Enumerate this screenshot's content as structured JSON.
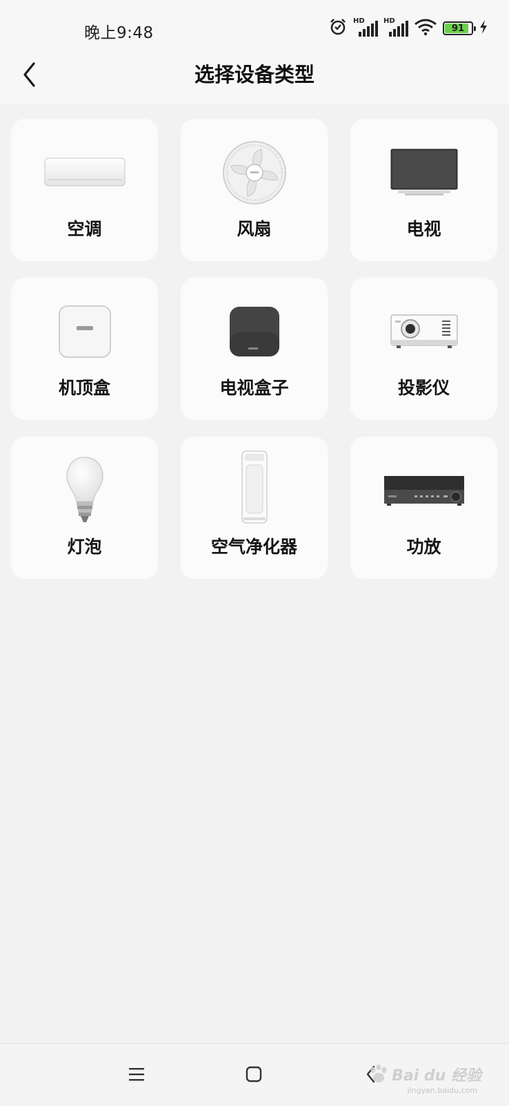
{
  "status_bar": {
    "time": "晚上9:48",
    "hd_label_1": "HD",
    "hd_label_2": "HD",
    "battery_text": "91",
    "battery_level": 0.91,
    "battery_color": "#6ad14a",
    "icons": [
      "alarm-icon",
      "signal-icon",
      "signal-icon",
      "wifi-icon",
      "battery-icon",
      "charging-icon"
    ]
  },
  "header": {
    "title": "选择设备类型",
    "back_icon": "back-chevron-icon"
  },
  "devices": [
    {
      "label": "空调",
      "icon": "air-conditioner-icon"
    },
    {
      "label": "风扇",
      "icon": "fan-icon"
    },
    {
      "label": "电视",
      "icon": "tv-icon"
    },
    {
      "label": "机顶盒",
      "icon": "set-top-box-icon"
    },
    {
      "label": "电视盒子",
      "icon": "tv-box-icon"
    },
    {
      "label": "投影仪",
      "icon": "projector-icon"
    },
    {
      "label": "灯泡",
      "icon": "light-bulb-icon"
    },
    {
      "label": "空气净化器",
      "icon": "air-purifier-icon"
    },
    {
      "label": "功放",
      "icon": "amplifier-icon"
    }
  ],
  "nav_bar": {
    "buttons": [
      "menu-icon",
      "home-icon",
      "back-icon"
    ]
  },
  "watermark": {
    "text": "Bai du 经验",
    "sub": "jingyan.baidu.com"
  }
}
